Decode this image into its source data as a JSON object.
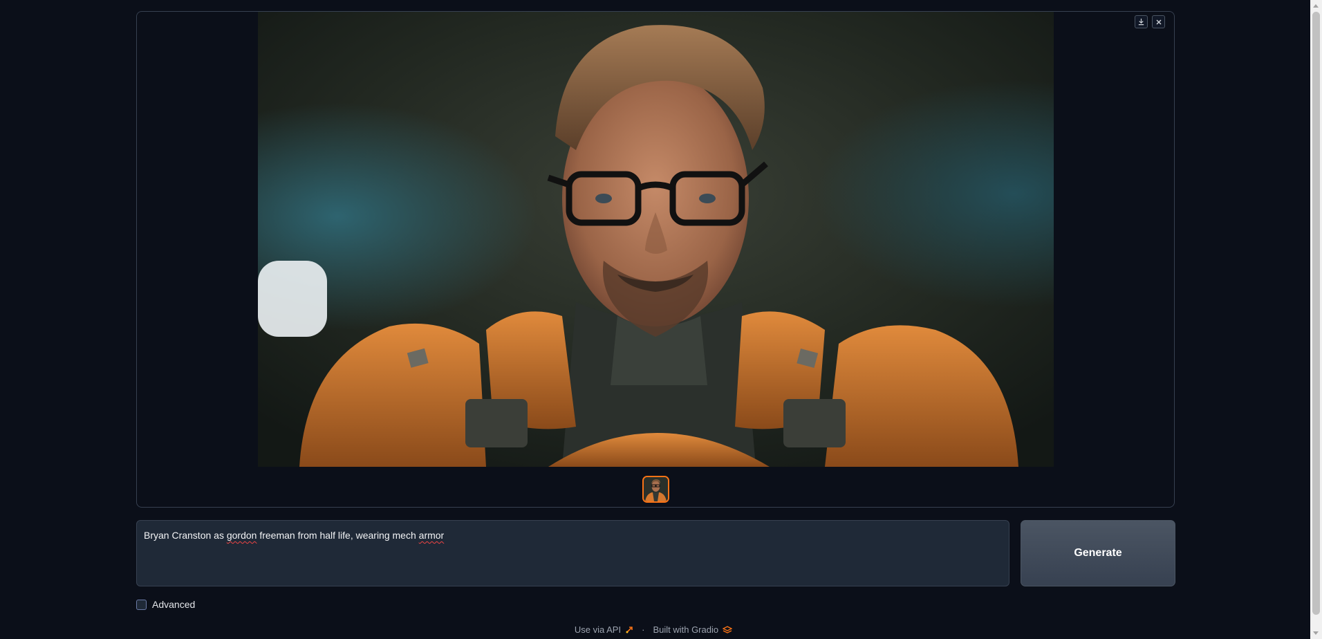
{
  "gallery": {
    "download_icon": "download-icon",
    "close_icon": "close-icon",
    "image_description": "generated-portrait"
  },
  "prompt": {
    "value_parts": [
      "Bryan Cranston as ",
      "gordon",
      " freeman from half life, wearing mech ",
      "armor"
    ]
  },
  "generate": {
    "label": "Generate"
  },
  "advanced": {
    "label": "Advanced",
    "checked": false
  },
  "footer": {
    "api_label": "Use via API",
    "separator": "·",
    "built_label": "Built with Gradio"
  },
  "colors": {
    "background": "#0b0f19",
    "accent": "#f97316",
    "panel": "#1f2937"
  }
}
